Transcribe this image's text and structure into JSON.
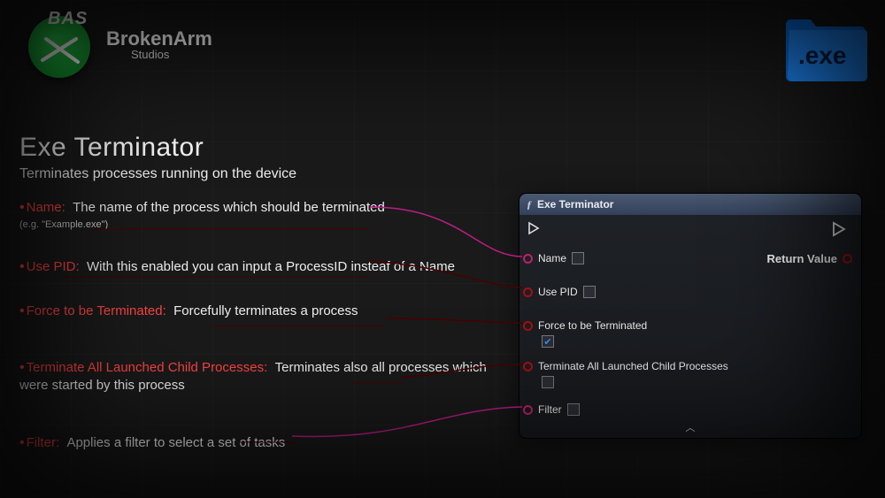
{
  "brand": {
    "badge": "BAS",
    "name": "BrokenArm",
    "sub": "Studios",
    "exe_label": ".exe"
  },
  "title": "Exe Terminator",
  "subtitle": "Terminates processes running on the device",
  "params": {
    "name": {
      "label": "Name:",
      "desc": "The name of the process which should be terminated",
      "eg": "(e.g. \"Example.exe\")"
    },
    "usepid": {
      "label": "Use PID:",
      "desc": "With this enabled you can input a ProcessID insteaf of a Name"
    },
    "force": {
      "label": "Force to be Terminated:",
      "desc": "Forcefully terminates a process"
    },
    "terminate_children": {
      "label": "Terminate All Launched Child Processes:",
      "desc": "Terminates also all processes which were started by this process"
    },
    "filter": {
      "label": "Filter:",
      "desc": "Applies a filter to select a set of tasks"
    }
  },
  "node": {
    "title": "Exe Terminator",
    "pins": {
      "name": "Name",
      "usepid": "Use PID",
      "force": "Force to be Terminated",
      "terminate_children": "Terminate All Launched Child Processes",
      "filter": "Filter",
      "return": "Return Value"
    },
    "checks": {
      "force": true,
      "terminate_children": false,
      "usepid": false,
      "name": false,
      "filter": false
    }
  }
}
